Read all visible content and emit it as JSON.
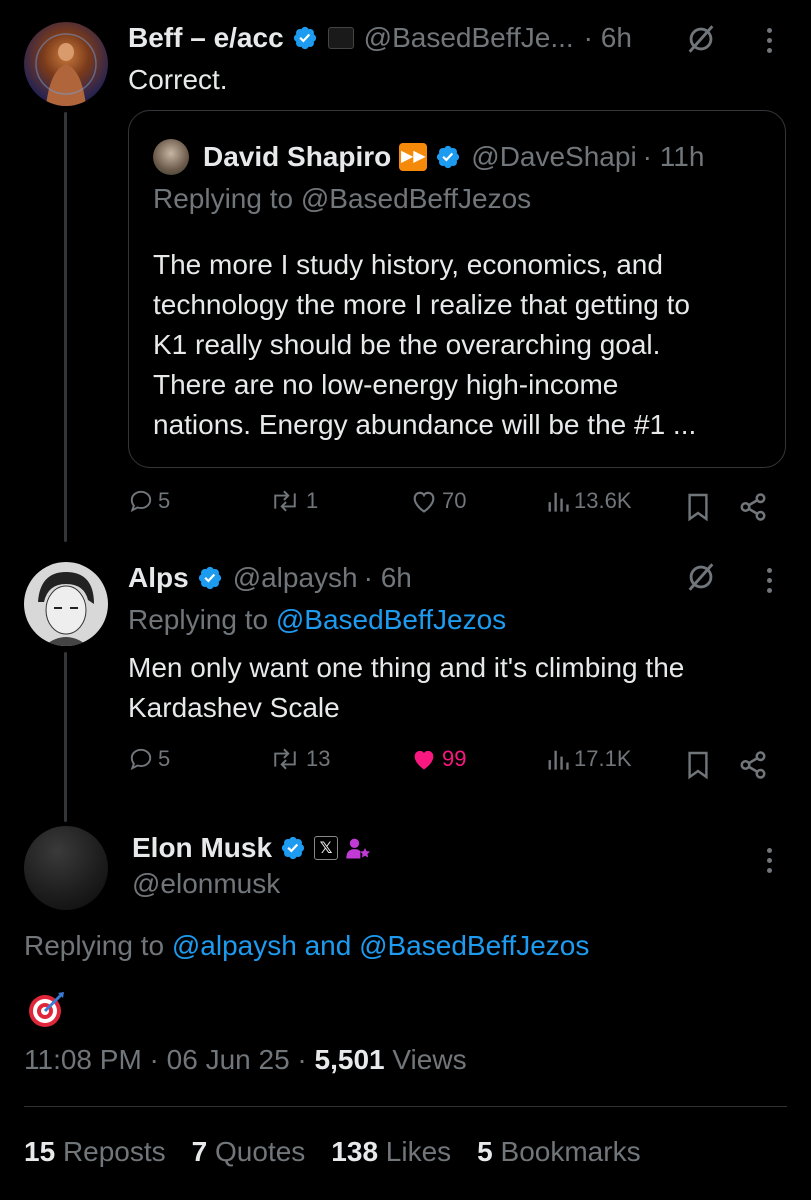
{
  "tweet1": {
    "name": "Beff – e/acc",
    "handle": "@BasedBeffJe...",
    "time": "· 6h",
    "text": "Correct.",
    "quote": {
      "name": "David Shapiro",
      "handle": "@DaveShapi",
      "time": "· 11h",
      "replying_prefix": "Replying to",
      "replying_to": "@BasedBeffJezos",
      "text_lines": [
        "The more I study history, economics, and",
        "technology the more I realize that getting to",
        "K1 really should be the overarching goal.",
        "There are no low-energy high-income",
        "nations. Energy abundance will be the #1 ..."
      ]
    },
    "actions": {
      "replies": "5",
      "reposts": "1",
      "likes": "70",
      "views": "13.6K"
    }
  },
  "tweet2": {
    "name": "Alps",
    "handle": "@alpaysh",
    "time": "· 6h",
    "replying_prefix": "Replying to",
    "replying_to": "@BasedBeffJezos",
    "text_lines": [
      "Men only want one thing and it's climbing the",
      "Kardashev Scale"
    ],
    "actions": {
      "replies": "5",
      "reposts": "13",
      "likes": "99",
      "views": "17.1K"
    }
  },
  "main": {
    "name": "Elon Musk",
    "handle": "@elonmusk",
    "replying_prefix": "Replying to",
    "replying_to": "@alpaysh and @BasedBeffJezos",
    "emoji": "🎯",
    "timestamp": "11:08 PM · 06 Jun 25 · ",
    "views_count": "5,501",
    "views_label": " Views",
    "stats": [
      {
        "count": "15",
        "label": "Reposts"
      },
      {
        "count": "7",
        "label": "Quotes"
      },
      {
        "count": "138",
        "label": "Likes"
      },
      {
        "count": "5",
        "label": "Bookmarks"
      }
    ]
  },
  "colors": {
    "background": "#000000",
    "text": "#e7e9ea",
    "muted": "#71767b",
    "link": "#1d9bf0",
    "like_active": "#f91880",
    "border": "#2f3336"
  },
  "icons": [
    "verified-badge-icon",
    "grok-icon",
    "more-icon",
    "reply-icon",
    "repost-icon",
    "like-icon",
    "views-icon",
    "bookmark-icon",
    "share-icon",
    "fast-forward-icon",
    "x-logo-icon",
    "target-icon"
  ]
}
